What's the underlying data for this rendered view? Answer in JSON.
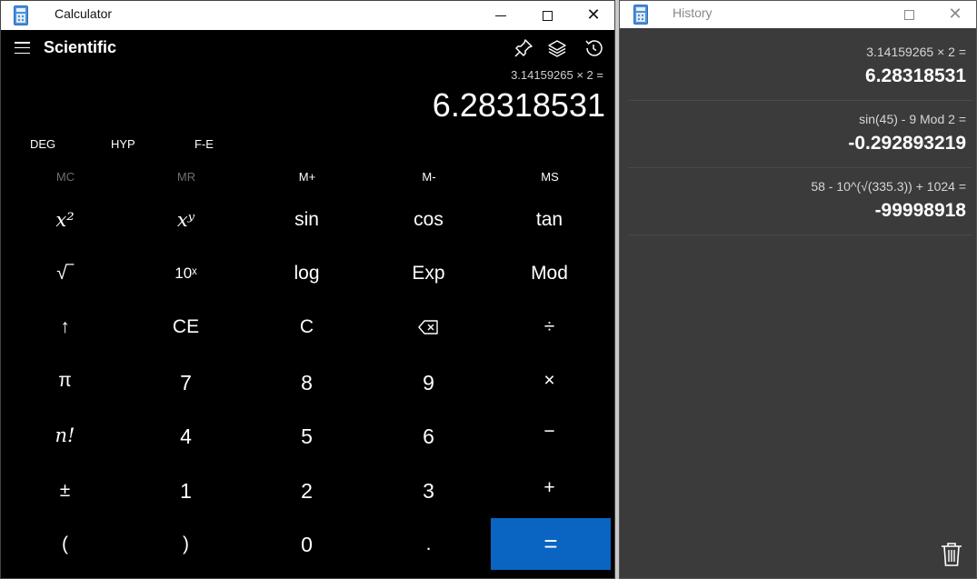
{
  "calculator": {
    "window_title": "Calculator",
    "mode_title": "Scientific",
    "expression": "3.14159265 × 2 =",
    "result": "6.28318531",
    "toggles": [
      "DEG",
      "HYP",
      "F-E"
    ],
    "memory": [
      {
        "label": "MC",
        "enabled": false
      },
      {
        "label": "MR",
        "enabled": false
      },
      {
        "label": "M+",
        "enabled": true
      },
      {
        "label": "M-",
        "enabled": true
      },
      {
        "label": "MS",
        "enabled": true
      }
    ],
    "keys": {
      "sin": "sin",
      "cos": "cos",
      "tan": "tan",
      "log": "log",
      "exp": "Exp",
      "mod": "Mod",
      "ce": "CE",
      "c": "C",
      "seven": "7",
      "eight": "8",
      "nine": "9",
      "four": "4",
      "five": "5",
      "six": "6",
      "one": "1",
      "two": "2",
      "three": "3",
      "open_paren": "(",
      "close_paren": ")",
      "zero": "0",
      "decimal": ".",
      "pi": "π",
      "plus_minus": "±",
      "up_arrow": "↑",
      "divide": "÷",
      "multiply": "×",
      "minus": "−",
      "plus": "+",
      "equals": "=",
      "sqrt": "√‾",
      "square": "x²",
      "power": "xʸ",
      "ten_power": "10ˣ",
      "factorial": "n!"
    },
    "icons": {
      "menu": "menu-icon",
      "pin": "pin-icon",
      "memory": "memory-layers-icon",
      "history": "history-icon",
      "backspace": "backspace-icon"
    },
    "accent_color": "#0a64c2"
  },
  "history": {
    "window_title": "History",
    "items": [
      {
        "expression": "3.14159265 × 2 =",
        "result": "6.28318531"
      },
      {
        "expression": "sin(45) - 9 Mod 2 =",
        "result": "-0.292893219"
      },
      {
        "expression": "58 - 10^(√(335.3)) + 1024 =",
        "result": "-99998918"
      }
    ],
    "icons": {
      "trash": "trash-icon"
    }
  }
}
